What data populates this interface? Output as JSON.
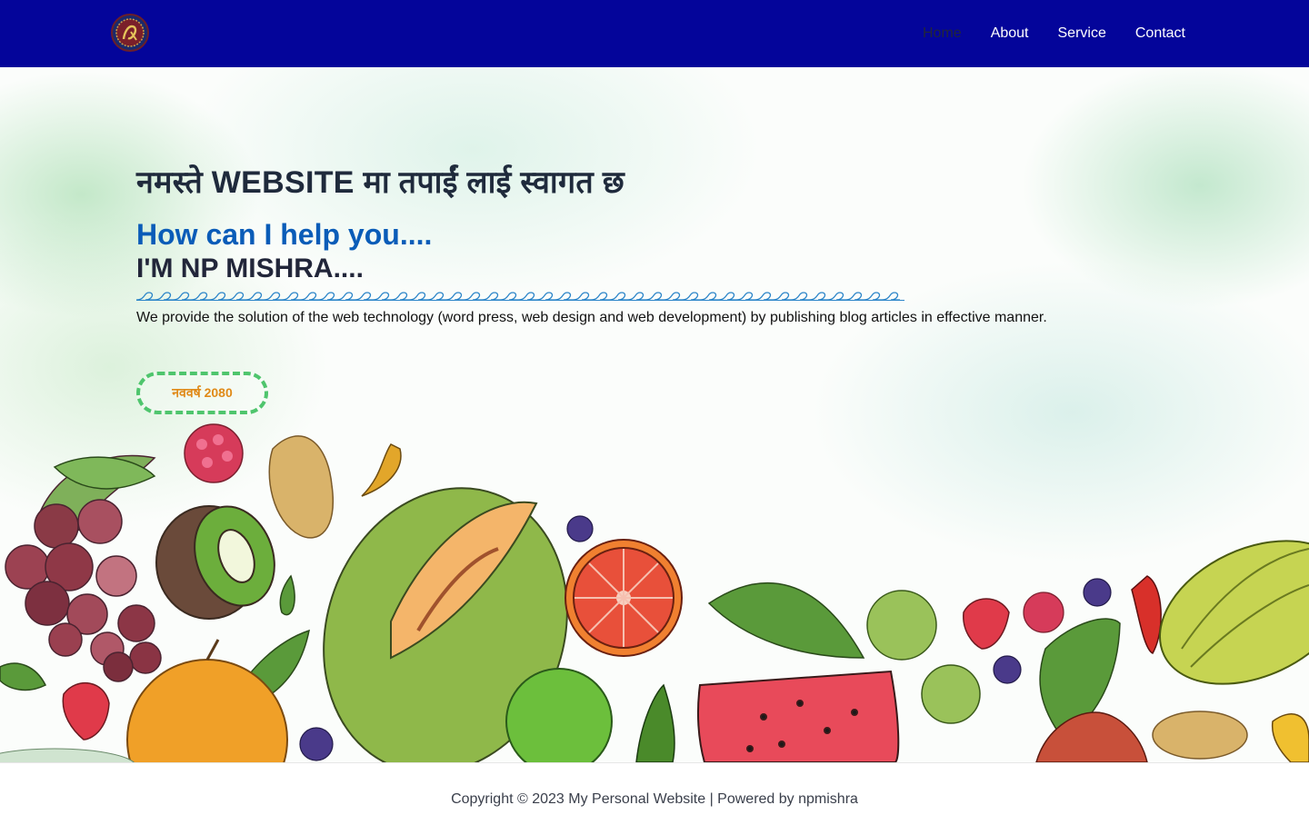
{
  "header": {
    "logo_icon": "np-monogram-seal",
    "nav": [
      {
        "label": "Home",
        "active": true
      },
      {
        "label": "About",
        "active": false
      },
      {
        "label": "Service",
        "active": false
      },
      {
        "label": "Contact",
        "active": false
      }
    ]
  },
  "hero": {
    "title": "नमस्ते WEBSITE मा तपाईं लाई स्वागत छ",
    "subtitle": "How can I help you....",
    "name": "I'M NP MISHRA....",
    "description": "We provide the solution of the web technology (word press, web design and web development) by publishing blog articles in effective manner.",
    "button_label": "नववर्ष 2080",
    "background_art": "watercolor-fruits-and-vegetables-illustration"
  },
  "footer": {
    "text": "Copyright © 2023 My Personal Website | Powered by npmishra"
  },
  "colors": {
    "header_bg": "#04059a",
    "nav_text": "#ffffff",
    "nav_active": "#22263a",
    "subtitle": "#0a5cb8",
    "button_border": "#4fc56d",
    "button_text": "#e08a18"
  }
}
